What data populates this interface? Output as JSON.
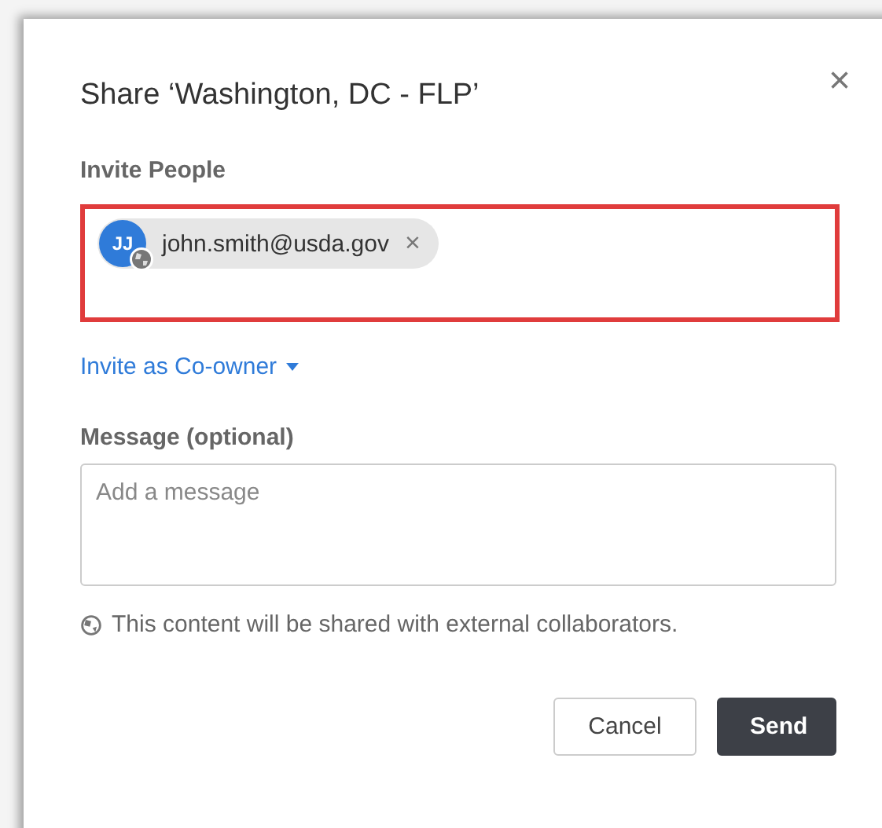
{
  "dialog": {
    "title": "Share ‘Washington, DC - FLP’",
    "close": "×"
  },
  "invite": {
    "label": "Invite People",
    "highlighted": true,
    "chips": [
      {
        "initials": "JJ",
        "email": "john.smith@usda.gov",
        "external": true,
        "remove": "×"
      }
    ]
  },
  "role": {
    "label": "Invite as Co-owner"
  },
  "message": {
    "label": "Message (optional)",
    "placeholder": "Add a message"
  },
  "notice": "This content will be shared with external collaborators.",
  "buttons": [
    {
      "label": "Cancel",
      "kind": "secondary"
    },
    {
      "label": "Send",
      "kind": "primary"
    }
  ]
}
